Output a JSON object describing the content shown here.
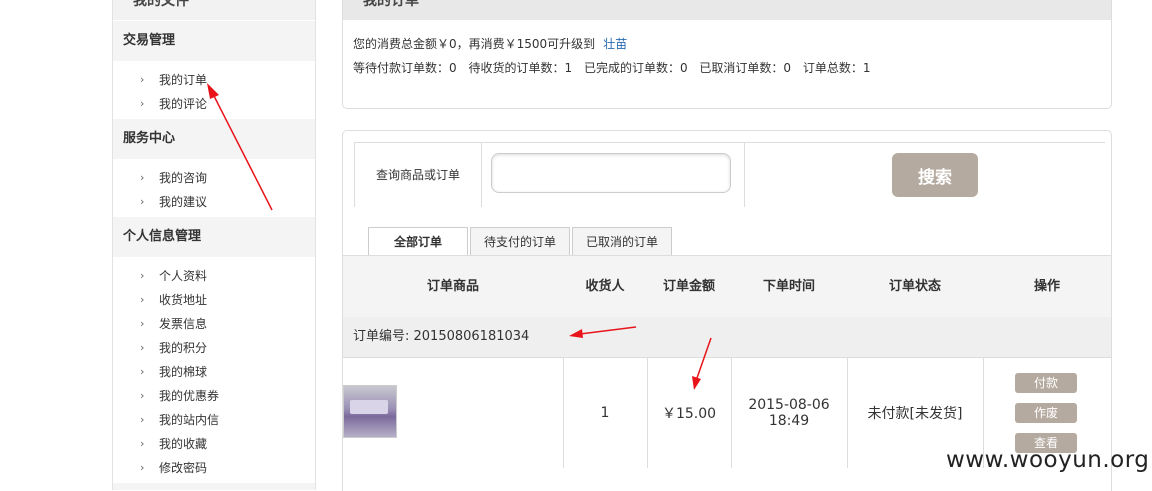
{
  "sidebar": {
    "top_title": "我的文件",
    "sections": [
      {
        "title": "交易管理",
        "items": [
          "我的订单",
          "我的评论"
        ]
      },
      {
        "title": "服务中心",
        "items": [
          "我的咨询",
          "我的建议"
        ]
      },
      {
        "title": "个人信息管理",
        "items": [
          "个人资料",
          "收货地址",
          "发票信息",
          "我的积分",
          "我的棉球",
          "我的优惠券",
          "我的站内信",
          "我的收藏",
          "修改密码"
        ]
      }
    ],
    "chevron": "›"
  },
  "summary": {
    "header": "我的订单",
    "spend_text": "您的消费总金额￥0，再消费￥1500可升级到",
    "level_link": "壮苗",
    "stats": [
      "等待付款订单数：0",
      "待收货的订单数：1",
      "已完成的订单数：0",
      "已取消订单数：0",
      "订单总数：1"
    ]
  },
  "search": {
    "label": "查询商品或订单",
    "placeholder": "",
    "button": "搜索"
  },
  "tabs": [
    "全部订单",
    "待支付的订单",
    "已取消的订单"
  ],
  "table": {
    "headers": [
      "订单商品",
      "收货人",
      "订单金额",
      "下单时间",
      "订单状态",
      "操作"
    ],
    "order_no": "订单编号: 20150806181034",
    "row": {
      "qty": "1",
      "amount": "￥15.00",
      "date": "2015-08-06",
      "time": "18:49",
      "status": "未付款[未发货]",
      "actions": [
        "付款",
        "作废",
        "查看"
      ]
    }
  },
  "watermark": "www.wooyun.org",
  "colors": {
    "accent_button": "#b5aa9f",
    "link": "#2a6ab0",
    "annotation_arrow": "#e8141a"
  }
}
